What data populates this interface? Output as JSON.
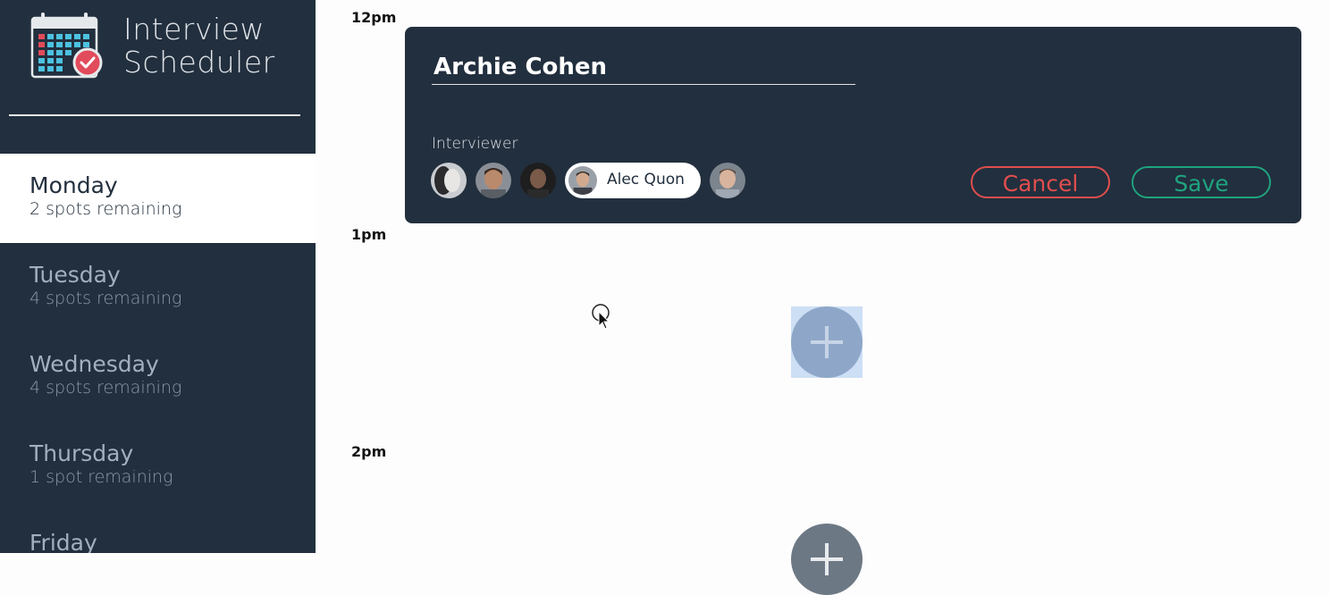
{
  "app": {
    "title_line1": "Interview",
    "title_line2": "Scheduler"
  },
  "sidebar": {
    "days": [
      {
        "name": "Monday",
        "spots": "2 spots remaining",
        "selected": true
      },
      {
        "name": "Tuesday",
        "spots": "4 spots remaining",
        "selected": false
      },
      {
        "name": "Wednesday",
        "spots": "4 spots remaining",
        "selected": false
      },
      {
        "name": "Thursday",
        "spots": "1 spot remaining",
        "selected": false
      },
      {
        "name": "Friday",
        "spots": "",
        "selected": false
      }
    ]
  },
  "schedule": {
    "times": [
      "12pm",
      "1pm",
      "2pm"
    ],
    "form": {
      "student_name": "Archie Cohen",
      "interviewer_heading": "Interviewer",
      "selected_interviewer": "Alec Quon",
      "cancel_label": "Cancel",
      "save_label": "Save"
    }
  },
  "colors": {
    "sidebar_bg": "#222f3e",
    "cancel": "#e04e4e",
    "save": "#1fa37f",
    "add_button": "#8ea7c8"
  },
  "icons": [
    "calendar-check-icon",
    "plus-icon",
    "mouse-cursor-icon"
  ]
}
